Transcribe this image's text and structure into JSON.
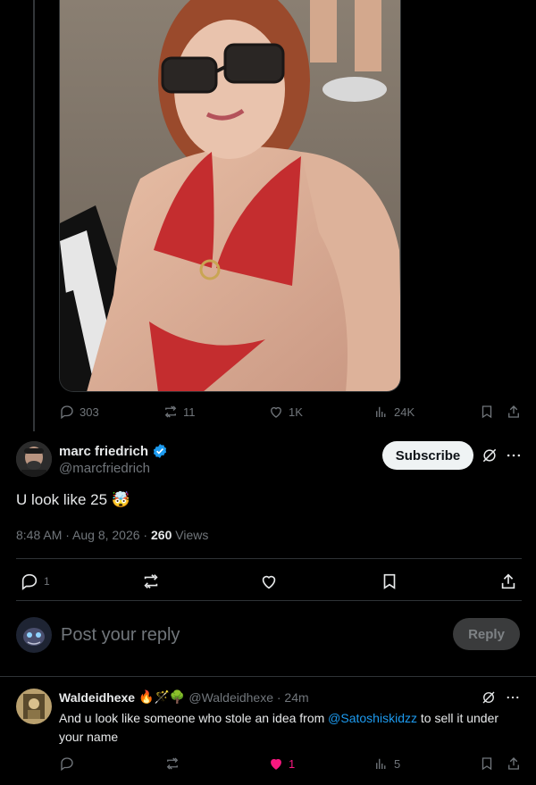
{
  "tweet_stats": {
    "replies": "303",
    "reposts": "11",
    "likes": "1K",
    "views": "24K"
  },
  "reply": {
    "author_name": "marc friedrich",
    "author_handle": "@marcfriedrich",
    "subscribe_label": "Subscribe",
    "text": "U look like 25 🤯",
    "timestamp": "8:48 AM · Aug 8, 2026 · ",
    "views_count": "260",
    "views_label": " Views",
    "replies_count": "1"
  },
  "composer": {
    "placeholder": "Post your reply",
    "reply_label": "Reply"
  },
  "comment": {
    "author_name": "Waldeidhexe",
    "emojis": "🔥🪄🌳",
    "handle_time": "@Waldeidhexe · 24m",
    "text_before": "And u look like someone who stole an idea from ",
    "mention": "@Satoshiskidzz",
    "text_after": " to sell it under your name",
    "likes": "1",
    "views": "5"
  },
  "colors": {
    "accent": "#1d9bf0",
    "like_active": "#f91880",
    "verified": "#1d9bf0"
  }
}
